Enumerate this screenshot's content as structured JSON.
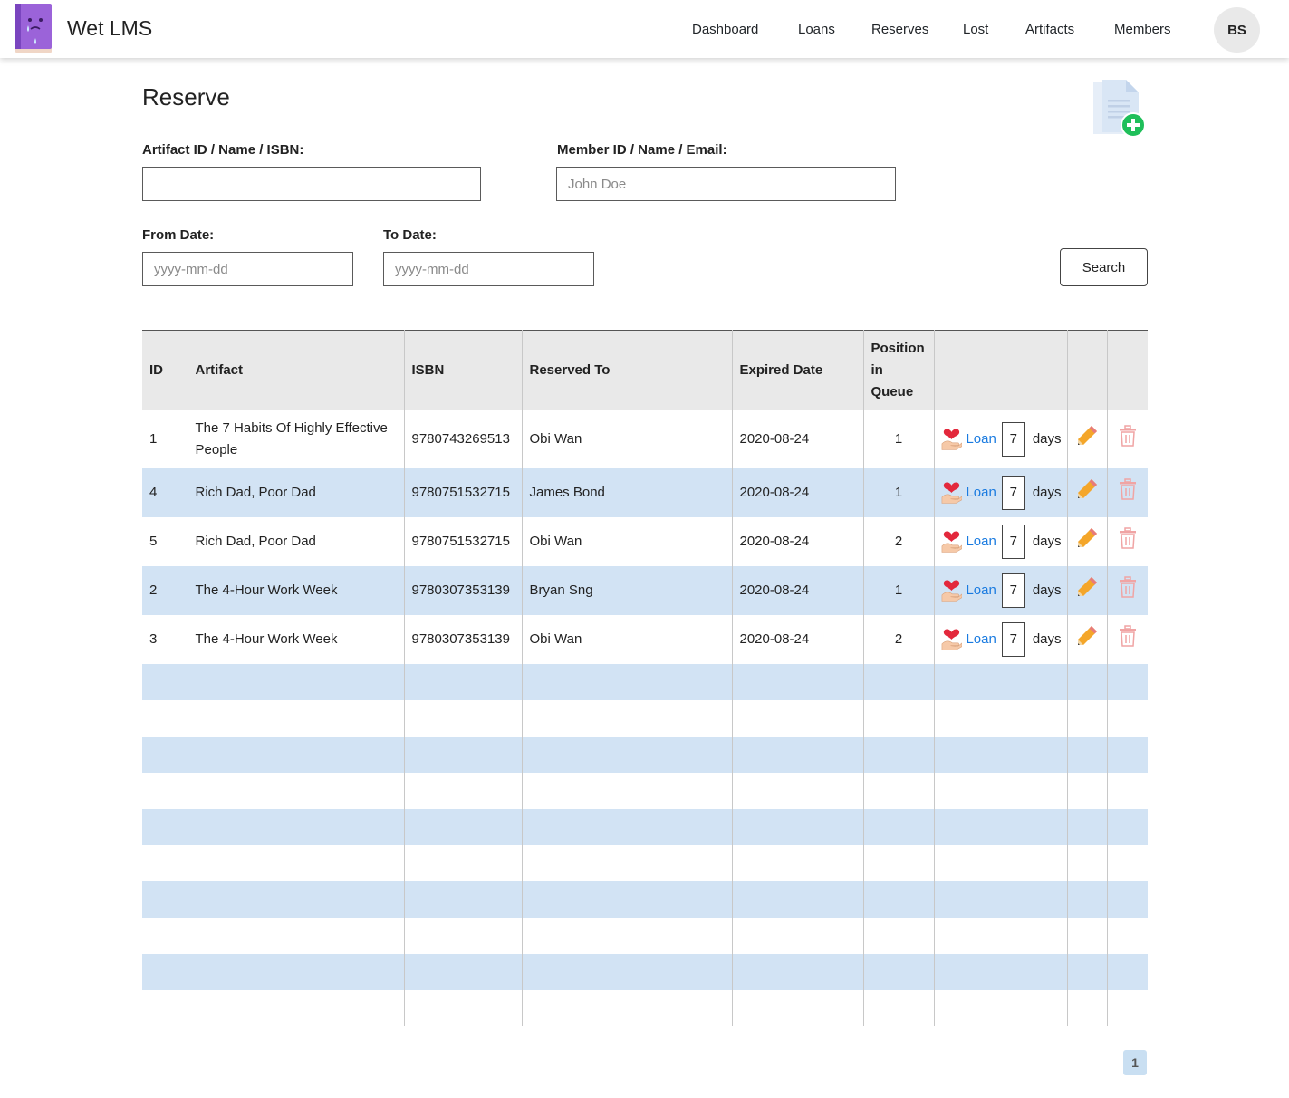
{
  "app": {
    "name": "Wet LMS"
  },
  "nav": {
    "items": [
      {
        "label": "Dashboard"
      },
      {
        "label": "Loans"
      },
      {
        "label": "Reserves"
      },
      {
        "label": "Lost"
      },
      {
        "label": "Artifacts"
      },
      {
        "label": "Members"
      }
    ],
    "avatar_initials": "BS"
  },
  "page": {
    "title": "Reserve"
  },
  "form": {
    "artifact_label": "Artifact ID / Name / ISBN:",
    "artifact_value": "",
    "member_label": "Member ID / Name / Email:",
    "member_placeholder": "John Doe",
    "from_label": "From Date:",
    "from_placeholder": "yyyy-mm-dd",
    "to_label": "To Date:",
    "to_placeholder": "yyyy-mm-dd",
    "search_label": "Search"
  },
  "table": {
    "headers": {
      "id": "ID",
      "artifact": "Artifact",
      "isbn": "ISBN",
      "reserved_to": "Reserved To",
      "expired_date": "Expired Date",
      "position": "Position in Queue"
    },
    "loan_label": "Loan",
    "days_label": "days",
    "rows": [
      {
        "id": "1",
        "artifact": "The 7 Habits Of Highly Effective People",
        "isbn": "9780743269513",
        "reserved_to": "Obi Wan",
        "expired_date": "2020-08-24",
        "position": "1",
        "days": "7"
      },
      {
        "id": "4",
        "artifact": "Rich Dad, Poor Dad",
        "isbn": "9780751532715",
        "reserved_to": "James Bond",
        "expired_date": "2020-08-24",
        "position": "1",
        "days": "7"
      },
      {
        "id": "5",
        "artifact": "Rich Dad, Poor Dad",
        "isbn": "9780751532715",
        "reserved_to": "Obi Wan",
        "expired_date": "2020-08-24",
        "position": "2",
        "days": "7"
      },
      {
        "id": "2",
        "artifact": "The 4-Hour Work Week",
        "isbn": "9780307353139",
        "reserved_to": "Bryan Sng",
        "expired_date": "2020-08-24",
        "position": "1",
        "days": "7"
      },
      {
        "id": "3",
        "artifact": "The 4-Hour Work Week",
        "isbn": "9780307353139",
        "reserved_to": "Obi Wan",
        "expired_date": "2020-08-24",
        "position": "2",
        "days": "7"
      }
    ]
  },
  "pagination": {
    "current": "1"
  },
  "colors": {
    "stripe": "#d2e3f4",
    "header_bg": "#e9e9e9",
    "link": "#1a7be0",
    "brand_purple": "#8e5bd6",
    "add_green": "#1fbf5a"
  },
  "icons": {
    "logo": "crying-book-icon",
    "add": "add-document-icon",
    "loan": "heart-hand-icon",
    "edit": "pencil-icon",
    "delete": "trash-icon"
  }
}
